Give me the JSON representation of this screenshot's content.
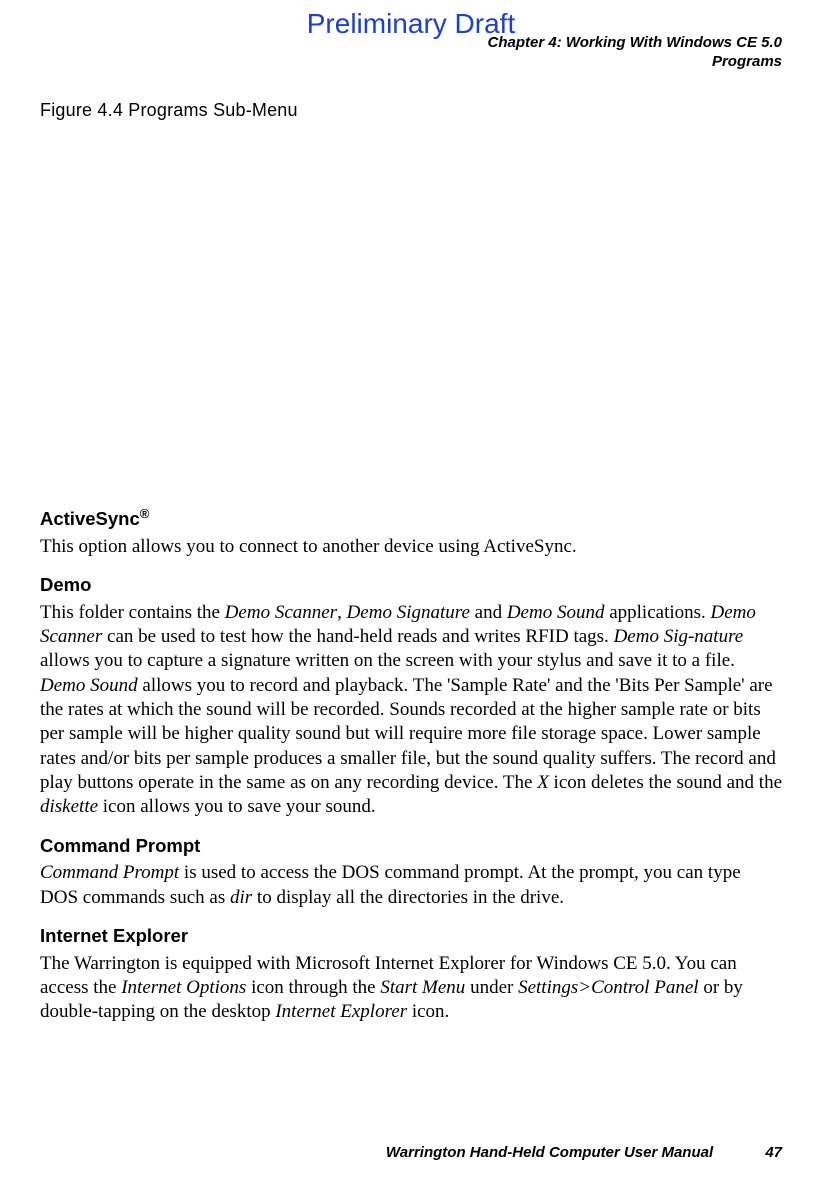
{
  "watermark": "Preliminary Draft",
  "header": {
    "line1": "Chapter 4:  Working With Windows CE 5.0",
    "line2": "Programs"
  },
  "figure_caption": "Figure 4.4  Programs Sub-Menu",
  "sections": {
    "activesync": {
      "title": "ActiveSync",
      "reg": "®",
      "body": "This option allows you to connect to another device using ActiveSync."
    },
    "demo": {
      "title": "Demo",
      "body_parts": [
        "This folder contains the ",
        "Demo Scanner",
        ", ",
        "Demo Signature",
        " and ",
        "Demo Sound",
        " applications. ",
        "Demo Scanner",
        " can be used to test how the hand-held reads and writes RFID tags. ",
        "Demo Sig-nature",
        " allows you to capture a signature written on the screen with your stylus and save it to a file. ",
        "Demo Sound",
        " allows you to record and playback. The 'Sample Rate' and the 'Bits Per Sample' are the rates at which the sound will be recorded. Sounds recorded at the higher sample rate or bits per sample will be higher quality sound but will require more file storage space. Lower sample rates and/or bits per sample produces a smaller file, but the sound quality suffers. The record and play buttons operate in the same as on any recording device. The ",
        "X",
        " icon deletes the sound and the ",
        "diskette",
        " icon allows you to save your sound."
      ]
    },
    "command_prompt": {
      "title": "Command Prompt",
      "body_parts": [
        "Command Prompt",
        " is used to access the DOS command prompt. At the prompt, you can type DOS commands such as ",
        "dir",
        " to display all the directories in the drive."
      ]
    },
    "internet_explorer": {
      "title": "Internet Explorer",
      "body_parts": [
        "The Warrington is equipped with Microsoft Internet Explorer for Windows CE 5.0. You can access the ",
        "Internet Options",
        " icon through the ",
        "Start Menu",
        " under ",
        "Settings>Control Panel",
        " or by double-tapping on the desktop ",
        "Internet Explorer",
        " icon."
      ]
    }
  },
  "footer": {
    "text": "Warrington Hand-Held Computer User Manual",
    "page": "47"
  }
}
